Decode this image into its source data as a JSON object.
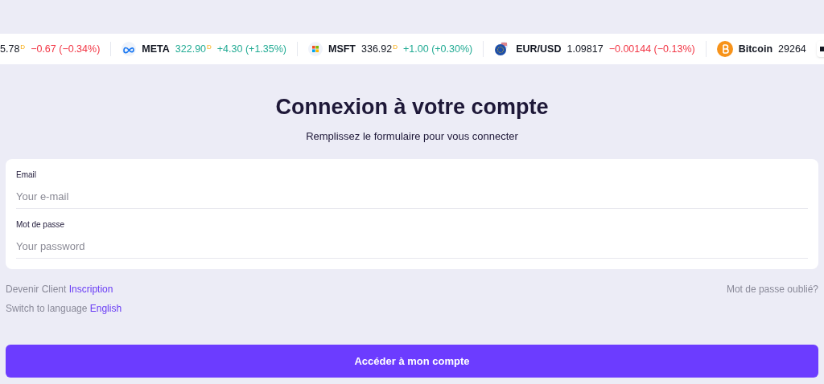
{
  "ticker": [
    {
      "kind": "none",
      "price": "5.78",
      "currency_mark": "D",
      "change": "−0.67 (−0.34%)",
      "rising": false,
      "price_rising": false
    },
    {
      "kind": "meta",
      "symbol": "META",
      "price": "322.90",
      "currency_mark": "D",
      "change": "+4.30 (+1.35%)",
      "rising": true,
      "price_rising": true
    },
    {
      "kind": "msft",
      "symbol": "MSFT",
      "price": "336.92",
      "currency_mark": "D",
      "change": "+1.00 (+0.30%)",
      "rising": true,
      "price_rising": false
    },
    {
      "kind": "eurusd",
      "symbol": "EUR/USD",
      "price": "1.09817",
      "change": "−0.00144 (−0.13%)",
      "rising": false,
      "price_rising": false
    },
    {
      "kind": "bitcoin",
      "symbol": "Bitcoin",
      "price": "29264",
      "price_rising": false
    }
  ],
  "title": "Connexion à votre compte",
  "subtitle": "Remplissez le formulaire pour vous connecter",
  "fields": [
    {
      "label": "Email",
      "placeholder": "Your e-mail"
    },
    {
      "label": "Mot de passe",
      "placeholder": "Your password"
    }
  ],
  "signup": {
    "text": "Devenir Client",
    "link": "Inscription"
  },
  "language": {
    "text": "Switch to language",
    "link": "English"
  },
  "forgot": "Mot de passe oublié?",
  "submit": "Accéder à mon compte"
}
